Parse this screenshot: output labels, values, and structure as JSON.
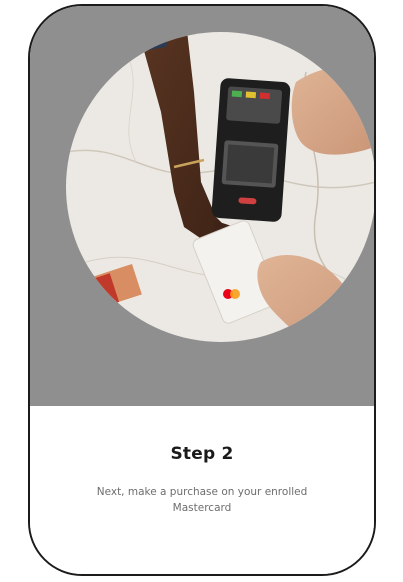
{
  "step": {
    "title": "Step 2",
    "description": "Next, make a purchase on your enrolled Mastercard"
  },
  "hero": {
    "image_subject": "hands-paying-with-card-at-terminal",
    "background_color": "#8f8f8f"
  },
  "colors": {
    "marble": "#ece9e4",
    "terminal": "#1e1e1e",
    "card": "#f4f2ee",
    "mastercard_red": "#eb001b",
    "mastercard_yellow": "#f79e1b"
  }
}
